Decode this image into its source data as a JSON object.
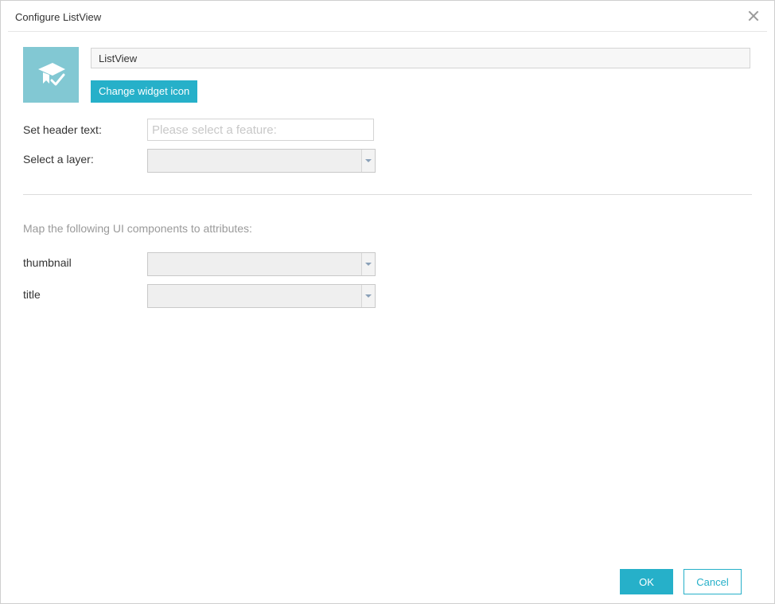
{
  "dialog": {
    "title": "Configure ListView",
    "close_icon": "close-icon"
  },
  "widget": {
    "icon": "graduation-cap-icon",
    "name_value": "ListView",
    "change_icon_label": "Change widget icon"
  },
  "form": {
    "header_label": "Set header text:",
    "header_placeholder": "Please select a feature:",
    "header_value": "",
    "layer_label": "Select a layer:",
    "layer_value": ""
  },
  "mapping": {
    "heading": "Map the following UI components to attributes:",
    "fields": [
      {
        "label": "thumbnail",
        "value": ""
      },
      {
        "label": "title",
        "value": ""
      }
    ]
  },
  "footer": {
    "ok_label": "OK",
    "cancel_label": "Cancel"
  },
  "colors": {
    "accent": "#26b0c9",
    "icon_tile": "#82c8d3"
  }
}
